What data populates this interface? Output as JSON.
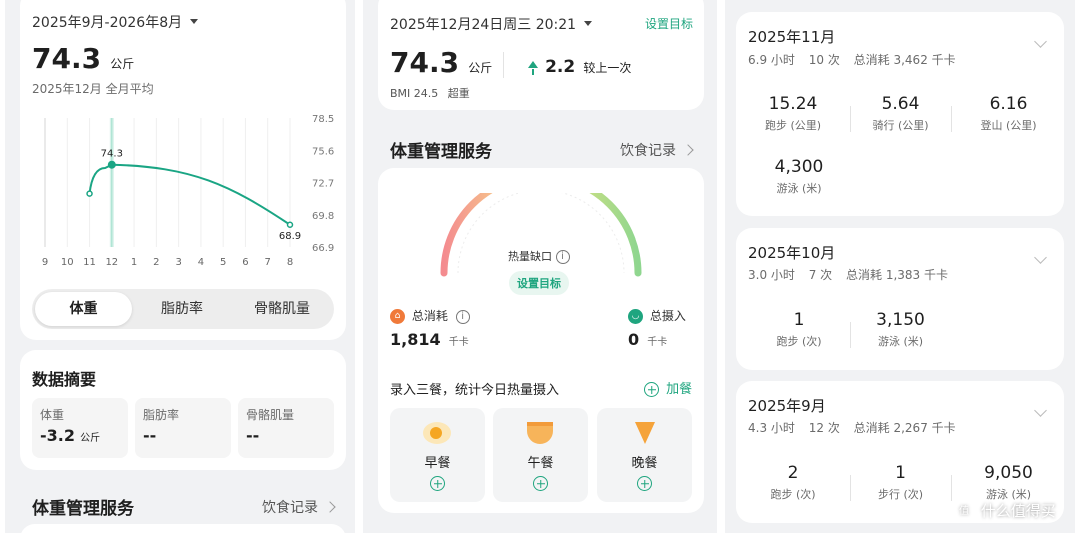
{
  "p1": {
    "range": "2025年9月-2026年8月",
    "weight": "74.3",
    "unit": "公斤",
    "sub": "2025年12月 全月平均",
    "chart_data": {
      "type": "line",
      "x": [
        "9",
        "10",
        "11",
        "12",
        "1",
        "2",
        "3",
        "4",
        "5",
        "6",
        "7",
        "8"
      ],
      "y_ticks": [
        "78.5",
        "75.6",
        "72.7",
        "69.8",
        "66.9"
      ],
      "ylim": [
        66.9,
        78.5
      ],
      "points": [
        {
          "x": 11,
          "y": 71.7
        },
        {
          "x": 11.7,
          "y": 74.0
        },
        {
          "x": 12,
          "y": 74.3,
          "label": "74.3"
        },
        {
          "x": 8,
          "y": 68.9,
          "label": "68.9"
        }
      ],
      "selected": "12",
      "color": "#1aa584"
    },
    "tabs": [
      "体重",
      "脂肪率",
      "骨骼肌量"
    ],
    "summary_title": "数据摘要",
    "summary": [
      {
        "label": "体重",
        "value": "-3.2",
        "unit": "公斤"
      },
      {
        "label": "脂肪率",
        "value": "--",
        "unit": ""
      },
      {
        "label": "骨骼肌量",
        "value": "--",
        "unit": ""
      }
    ],
    "service_title": "体重管理服务",
    "diet_link": "饮食记录"
  },
  "p2": {
    "date": "2025年12月24日周三 20:21",
    "set_goal": "设置目标",
    "weight": "74.3",
    "unit": "公斤",
    "delta": "2.2",
    "delta_label": "较上一次",
    "bmi": "BMI 24.5",
    "bmi_status": "超重",
    "service_title": "体重管理服务",
    "diet_link": "饮食记录",
    "gauge_label": "热量缺口",
    "gauge_button": "设置目标",
    "burn_label": "总消耗",
    "burn_value": "1,814",
    "burn_unit": "千卡",
    "intake_label": "总摄入",
    "intake_value": "0",
    "intake_unit": "千卡",
    "meals_prompt": "录入三餐，统计今日热量摄入",
    "add_meal": "加餐",
    "meals": [
      "早餐",
      "午餐",
      "晚餐"
    ],
    "colors": {
      "accent": "#1fa57f",
      "burn": "#f07a3a"
    }
  },
  "p3": {
    "months": [
      {
        "title": "2025年11月",
        "hours": "6.9 小时",
        "count": "10 次",
        "total": "总消耗 3,462 千卡",
        "stats": [
          {
            "value": "15.24",
            "label": "跑步 (公里)"
          },
          {
            "value": "5.64",
            "label": "骑行 (公里)"
          },
          {
            "value": "6.16",
            "label": "登山 (公里)"
          },
          {
            "value": "4,300",
            "label": "游泳 (米)"
          }
        ]
      },
      {
        "title": "2025年10月",
        "hours": "3.0 小时",
        "count": "7 次",
        "total": "总消耗 1,383 千卡",
        "stats": [
          {
            "value": "1",
            "label": "跑步 (次)"
          },
          {
            "value": "3,150",
            "label": "游泳 (米)"
          }
        ]
      },
      {
        "title": "2025年9月",
        "hours": "4.3 小时",
        "count": "12 次",
        "total": "总消耗 2,267 千卡",
        "stats": [
          {
            "value": "2",
            "label": "跑步 (次)"
          },
          {
            "value": "1",
            "label": "步行 (次)"
          },
          {
            "value": "9,050",
            "label": "游泳 (米)"
          }
        ]
      }
    ]
  },
  "watermark": "什么值得买"
}
